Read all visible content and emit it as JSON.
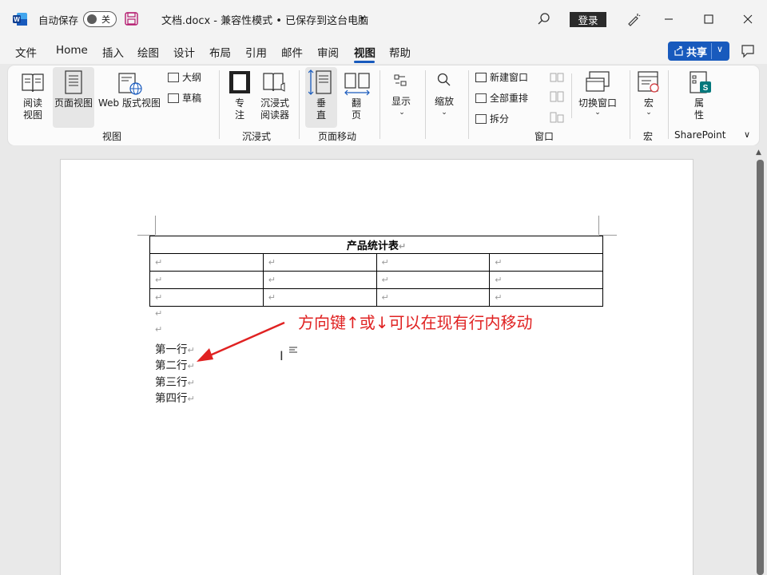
{
  "titlebar": {
    "autosave_label": "自动保存",
    "autosave_state": "关",
    "document_title": "文档.docx  -  兼容性模式 • 已保存到这台电脑",
    "login_label": "登录"
  },
  "tabs": [
    "文件",
    "Home",
    "插入",
    "绘图",
    "设计",
    "布局",
    "引用",
    "邮件",
    "审阅",
    "视图",
    "帮助"
  ],
  "active_tab": "视图",
  "share_label": "共享",
  "ribbon": {
    "view_group": {
      "read_mode": [
        "阅读",
        "视图"
      ],
      "print_layout": "页面视图",
      "web_layout": "Web 版式视图",
      "outline": "大纲",
      "draft": "草稿",
      "label": "视图"
    },
    "immersive_group": {
      "focus": [
        "专",
        "注"
      ],
      "reader": [
        "沉浸式",
        "阅读器"
      ],
      "label": "沉浸式"
    },
    "page_move_group": {
      "vertical": [
        "垂",
        "直"
      ],
      "side": [
        "翻",
        "页"
      ],
      "label": "页面移动"
    },
    "show": "显示",
    "zoom": "缩放",
    "window_group": {
      "new_window": "新建窗口",
      "arrange_all": "全部重排",
      "split": "拆分",
      "switch_window": "切换窗口",
      "label": "窗口"
    },
    "macros_group": {
      "macros": "宏",
      "label": "宏"
    },
    "sharepoint_group": {
      "properties": [
        "属",
        "性"
      ],
      "label": "SharePoint"
    }
  },
  "document": {
    "table_title": "产品统计表",
    "table_rows": 3,
    "table_cols": 4,
    "lines": [
      "第一行",
      "第二行",
      "第三行",
      "第四行"
    ]
  },
  "annotation": "方向键↑或↓可以在现有行内移动",
  "colors": {
    "accent": "#185abd",
    "annotation": "#e02222"
  }
}
